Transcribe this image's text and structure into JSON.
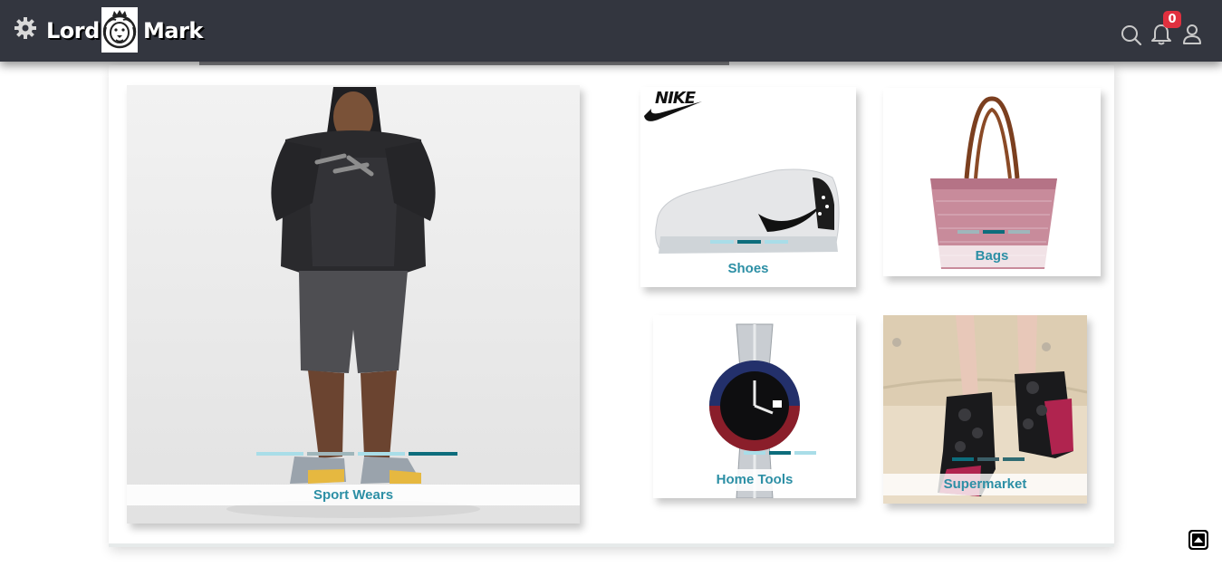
{
  "header": {
    "brand_left": "Lord",
    "brand_right": "Mark",
    "notifications_count": "0"
  },
  "cards": {
    "sport": {
      "label": "Sport Wears"
    },
    "shoes": {
      "label": "Shoes",
      "brand_logo_text": "NIKE"
    },
    "bags": {
      "label": "Bags"
    },
    "tools": {
      "label": "Home Tools"
    },
    "market": {
      "label": "Supermarket"
    }
  },
  "icons": {
    "settings": "gear-icon",
    "logo": "lion-logo-icon",
    "search": "search-icon",
    "notifications": "bell-icon",
    "account": "user-icon",
    "scroll_top": "scroll-top-icon"
  },
  "colors": {
    "header_bg": "#33363f",
    "label_text": "#2c8fa5",
    "indicator_active": "#0d6d7c",
    "indicator_inactive": "#a9dde8",
    "badge": "#e0303f"
  }
}
